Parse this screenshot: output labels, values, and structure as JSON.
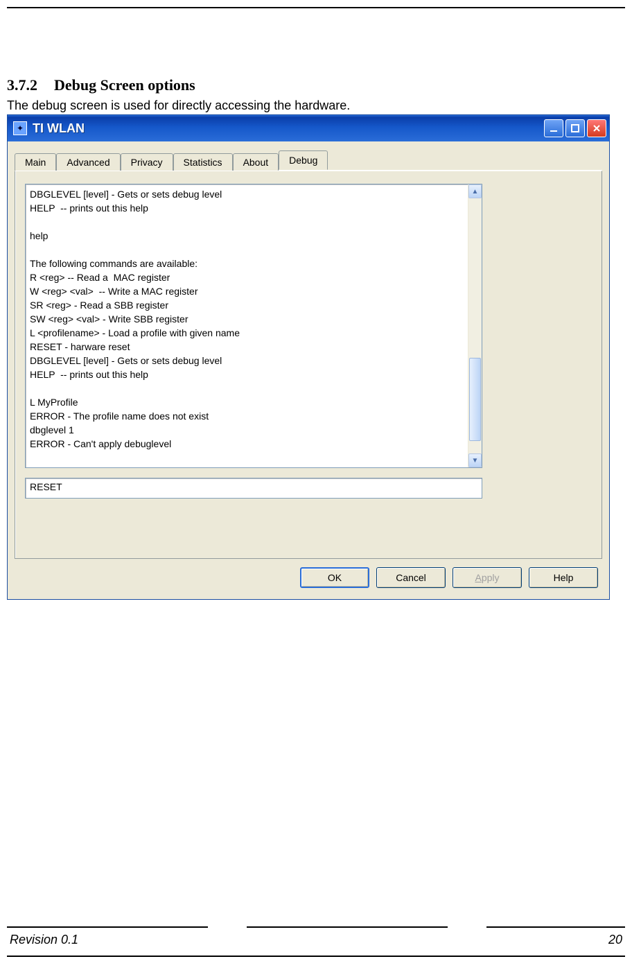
{
  "doc": {
    "section_number": "3.7.2",
    "section_title": "Debug Screen options",
    "intro": "The debug screen is used for directly accessing the hardware.",
    "footer_left": "Revision 0.1",
    "footer_right": "20"
  },
  "window": {
    "title": "TI WLAN",
    "tabs": [
      "Main",
      "Advanced",
      "Privacy",
      "Statistics",
      "About",
      "Debug"
    ],
    "active_tab_index": 5,
    "output_text": "DBGLEVEL [level] - Gets or sets debug level\nHELP  -- prints out this help\n\nhelp\n\nThe following commands are available:\nR <reg> -- Read a  MAC register\nW <reg> <val>  -- Write a MAC register\nSR <reg> - Read a SBB register\nSW <reg> <val> - Write SBB register\nL <profilename> - Load a profile with given name\nRESET - harware reset\nDBGLEVEL [level] - Gets or sets debug level\nHELP  -- prints out this help\n\nL MyProfile\nERROR - The profile name does not exist\ndbglevel 1\nERROR - Can't apply debuglevel",
    "input_value": "RESET",
    "buttons": {
      "ok": "OK",
      "cancel": "Cancel",
      "apply": "Apply",
      "help": "Help"
    },
    "colors": {
      "titlebar": "#1557c9",
      "chrome": "#ece9d8",
      "border": "#7f9db9"
    }
  }
}
